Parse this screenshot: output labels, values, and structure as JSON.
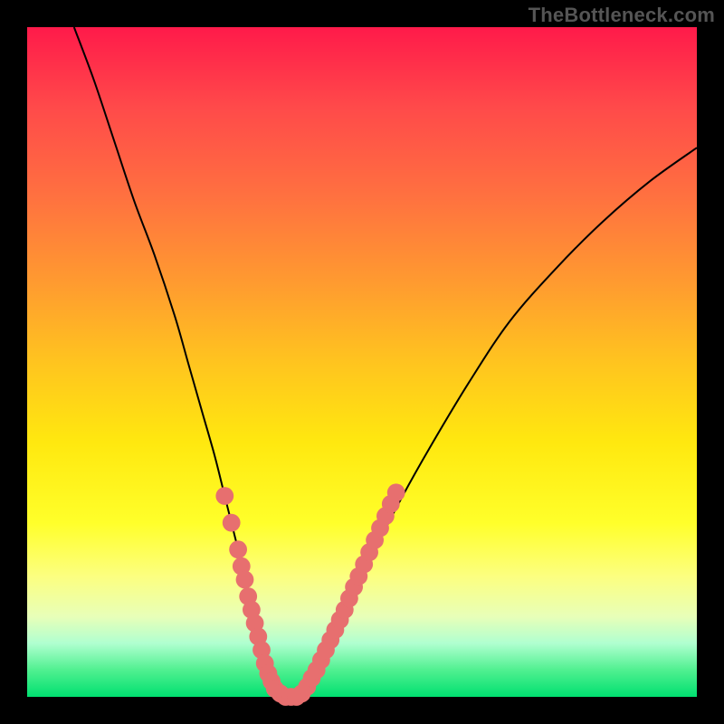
{
  "watermark": "TheBottleneck.com",
  "colors": {
    "gradient_top": "#ff1a4a",
    "gradient_bottom": "#00e070",
    "curve": "#000000",
    "marker_fill": "#e76f6f",
    "marker_stroke": "#b94c4c",
    "frame": "#000000"
  },
  "chart_data": {
    "type": "line",
    "title": "",
    "xlabel": "",
    "ylabel": "",
    "xlim": [
      0,
      100
    ],
    "ylim": [
      0,
      100
    ],
    "grid": false,
    "series": [
      {
        "name": "left-branch",
        "x": [
          7,
          10,
          13,
          16,
          19,
          22,
          24,
          26,
          28,
          29.5,
          31,
          32.5,
          34,
          35.5,
          37
        ],
        "y": [
          100,
          92,
          83,
          74,
          66,
          57,
          50,
          43,
          36,
          30,
          24,
          18,
          12,
          6,
          0
        ]
      },
      {
        "name": "right-branch",
        "x": [
          41,
          43,
          45,
          48,
          51,
          55,
          60,
          66,
          72,
          79,
          86,
          93,
          100
        ],
        "y": [
          0,
          3,
          7,
          13,
          20,
          28,
          37,
          47,
          56,
          64,
          71,
          77,
          82
        ]
      }
    ],
    "flat_bottom": {
      "x_start": 37,
      "x_end": 41,
      "y": 0
    },
    "markers": [
      {
        "x": 29.5,
        "y": 30,
        "r": 1.6
      },
      {
        "x": 30.5,
        "y": 26,
        "r": 1.6
      },
      {
        "x": 31.5,
        "y": 22,
        "r": 1.6
      },
      {
        "x": 32.0,
        "y": 19.5,
        "r": 1.6
      },
      {
        "x": 32.5,
        "y": 17.5,
        "r": 1.6
      },
      {
        "x": 33.0,
        "y": 15.0,
        "r": 1.6
      },
      {
        "x": 33.5,
        "y": 13.0,
        "r": 1.6
      },
      {
        "x": 34.0,
        "y": 11.0,
        "r": 1.6
      },
      {
        "x": 34.5,
        "y": 9.0,
        "r": 1.6
      },
      {
        "x": 35.0,
        "y": 7.0,
        "r": 1.6
      },
      {
        "x": 35.5,
        "y": 5.0,
        "r": 1.6
      },
      {
        "x": 36.0,
        "y": 3.5,
        "r": 1.6
      },
      {
        "x": 36.5,
        "y": 2.3,
        "r": 1.6
      },
      {
        "x": 37.0,
        "y": 1.2,
        "r": 1.6
      },
      {
        "x": 37.8,
        "y": 0.5,
        "r": 1.6
      },
      {
        "x": 38.6,
        "y": 0.0,
        "r": 1.6
      },
      {
        "x": 39.4,
        "y": 0.0,
        "r": 1.6
      },
      {
        "x": 40.2,
        "y": 0.0,
        "r": 1.6
      },
      {
        "x": 41.0,
        "y": 0.5,
        "r": 1.6
      },
      {
        "x": 41.8,
        "y": 1.5,
        "r": 1.6
      },
      {
        "x": 42.5,
        "y": 2.8,
        "r": 1.6
      },
      {
        "x": 43.2,
        "y": 4.0,
        "r": 1.6
      },
      {
        "x": 43.9,
        "y": 5.5,
        "r": 1.6
      },
      {
        "x": 44.6,
        "y": 7.0,
        "r": 1.6
      },
      {
        "x": 45.3,
        "y": 8.5,
        "r": 1.6
      },
      {
        "x": 46.0,
        "y": 10.0,
        "r": 1.6
      },
      {
        "x": 46.7,
        "y": 11.5,
        "r": 1.6
      },
      {
        "x": 47.4,
        "y": 13.0,
        "r": 1.6
      },
      {
        "x": 48.1,
        "y": 14.7,
        "r": 1.6
      },
      {
        "x": 48.8,
        "y": 16.4,
        "r": 1.6
      },
      {
        "x": 49.5,
        "y": 18.0,
        "r": 1.6
      },
      {
        "x": 50.3,
        "y": 19.8,
        "r": 1.6
      },
      {
        "x": 51.1,
        "y": 21.6,
        "r": 1.6
      },
      {
        "x": 51.9,
        "y": 23.4,
        "r": 1.6
      },
      {
        "x": 52.7,
        "y": 25.2,
        "r": 1.6
      },
      {
        "x": 53.5,
        "y": 27.0,
        "r": 1.6
      },
      {
        "x": 54.3,
        "y": 28.8,
        "r": 1.6
      },
      {
        "x": 55.1,
        "y": 30.5,
        "r": 1.6
      }
    ]
  }
}
